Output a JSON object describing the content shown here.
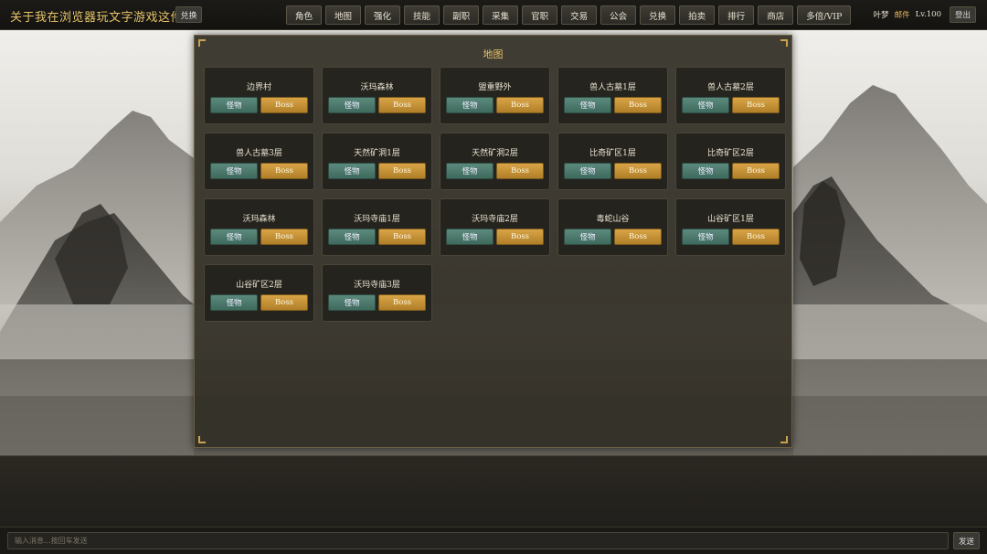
{
  "header": {
    "title": "关于我在浏览器玩文字游戏这件事",
    "redeem_label": "兑换",
    "nav": [
      "角色",
      "地图",
      "强化",
      "技能",
      "副职",
      "采集",
      "官职",
      "交易",
      "公会",
      "兑换",
      "拍卖",
      "排行",
      "商店",
      "多倍/VIP"
    ],
    "user": {
      "name": "叶梦",
      "mail": "邮件",
      "level": "Lv.100",
      "logout": "登出"
    }
  },
  "map_panel": {
    "title": "地图",
    "monster_label": "怪物",
    "boss_label": "Boss",
    "maps": [
      "边界村",
      "沃玛森林",
      "盟重野外",
      "兽人古墓1层",
      "兽人古墓2层",
      "兽人古墓3层",
      "天然矿洞1层",
      "天然矿洞2层",
      "比奇矿区1层",
      "比奇矿区2层",
      "沃玛森林",
      "沃玛寺庙1层",
      "沃玛寺庙2层",
      "毒蛇山谷",
      "山谷矿区1层",
      "山谷矿区2层",
      "沃玛寺庙3层"
    ]
  },
  "chat": {
    "placeholder": "输入消息...按回车发送",
    "send_label": "发送"
  }
}
